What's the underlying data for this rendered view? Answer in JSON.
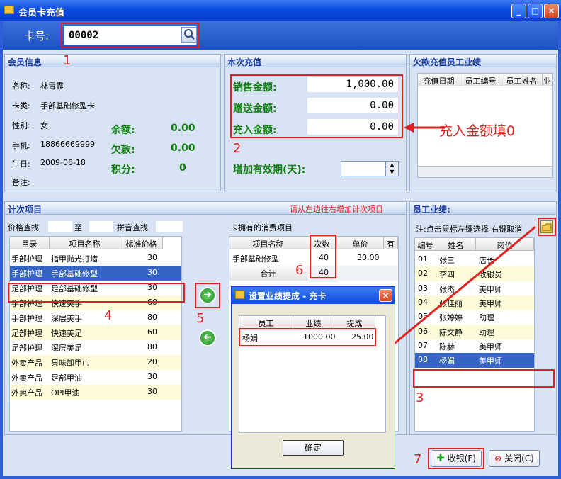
{
  "window": {
    "title": "会员卡充值",
    "minimize_glyph": "_",
    "restore_glyph": "□",
    "close_glyph": "×"
  },
  "card_bar": {
    "label": "卡号:",
    "card_number": "00002"
  },
  "member_info": {
    "header": "会员信息",
    "fields": [
      {
        "label": "名称:",
        "value": "林青霞"
      },
      {
        "label": "卡类:",
        "value": "手部基础修型卡"
      },
      {
        "label": "性别:",
        "value": "女"
      },
      {
        "label": "手机:",
        "value": "18866669999"
      },
      {
        "label": "生日:",
        "value": "2009-06-18"
      },
      {
        "label": "备注:",
        "value": ""
      }
    ],
    "balances": [
      {
        "label": "余额:",
        "value": "0.00"
      },
      {
        "label": "欠款:",
        "value": "0.00"
      },
      {
        "label": "积分:",
        "value": "0"
      }
    ]
  },
  "recharge": {
    "header": "本次充值",
    "sale_label": "销售金额:",
    "sale_value": "1,000.00",
    "gift_label": "赠送金额:",
    "gift_value": "0.00",
    "charge_label": "充入金额:",
    "charge_value": "0.00",
    "validity_label": "增加有效期(天):",
    "validity_value": ""
  },
  "arrears": {
    "header": "欠款充值员工业绩",
    "columns": [
      "充值日期",
      "员工编号",
      "员工姓名",
      "业"
    ]
  },
  "annotations": {
    "n1": "1",
    "n2": "2",
    "n3": "3",
    "n4": "4",
    "n5": "5",
    "n6": "6",
    "n7": "7",
    "charge_hint": "充入金额填0"
  },
  "count_items": {
    "header": "计次项目",
    "hint": "请从左边往右增加计次项目",
    "price_search_label": "价格查找",
    "to_label": "至",
    "pinyin_label": "拼音查找",
    "columns": [
      "目录",
      "项目名称",
      "标准价格"
    ],
    "rows": [
      {
        "cat": "手部护理",
        "name": "指甲抛光打蜡",
        "price": "30"
      },
      {
        "cat": "手部护理",
        "name": "手部基础修型",
        "price": "30"
      },
      {
        "cat": "足部护理",
        "name": "足部基础修型",
        "price": "30"
      },
      {
        "cat": "手部护理",
        "name": "快速美手",
        "price": "60"
      },
      {
        "cat": "手部护理",
        "name": "深层美手",
        "price": "80"
      },
      {
        "cat": "足部护理",
        "name": "快速美足",
        "price": "60"
      },
      {
        "cat": "足部护理",
        "name": "深层美足",
        "price": "80"
      },
      {
        "cat": "外卖产品",
        "name": "果味卸甲巾",
        "price": "20"
      },
      {
        "cat": "外卖产品",
        "name": "足部甲油",
        "price": "30"
      },
      {
        "cat": "外卖产品",
        "name": "OPI甲油",
        "price": "30"
      }
    ],
    "owned_title": "卡拥有的消费项目",
    "owned_columns": [
      "项目名称",
      "次数",
      "单价",
      "有"
    ],
    "owned_rows": [
      {
        "name": "手部基础修型",
        "count": "40",
        "price": "30.00"
      }
    ],
    "total_label": "合计",
    "total_count": "40",
    "add_glyph": "➔",
    "remove_glyph": "➔"
  },
  "staff": {
    "header": "员工业绩:",
    "note": "注:点击鼠标左键选择 右键取消",
    "columns": [
      "编号",
      "姓名",
      "岗位"
    ],
    "rows": [
      {
        "id": "01",
        "name": "张三",
        "role": "店长"
      },
      {
        "id": "02",
        "name": "李四",
        "role": "收银员"
      },
      {
        "id": "03",
        "name": "张杰",
        "role": "美甲师"
      },
      {
        "id": "04",
        "name": "张佳丽",
        "role": "美甲师"
      },
      {
        "id": "05",
        "name": "张婷婷",
        "role": "助理"
      },
      {
        "id": "06",
        "name": "陈文静",
        "role": "助理"
      },
      {
        "id": "07",
        "name": "陈赫",
        "role": "美甲师"
      },
      {
        "id": "08",
        "name": "杨娟",
        "role": "美甲师"
      }
    ]
  },
  "dialog": {
    "title": "设置业绩提成 - 充卡",
    "columns": [
      "员工",
      "业绩",
      "提成"
    ],
    "row": {
      "name": "杨娟",
      "perf": "1000.00",
      "comm": "25.00"
    },
    "ok_label": "确定",
    "close_glyph": "×"
  },
  "footer": {
    "checkout_label": "收银(F)",
    "close_label": "关闭(C)"
  },
  "colors": {
    "accent_red": "#e02020",
    "selection_blue": "#3564c6",
    "balance_green": "#118011"
  }
}
